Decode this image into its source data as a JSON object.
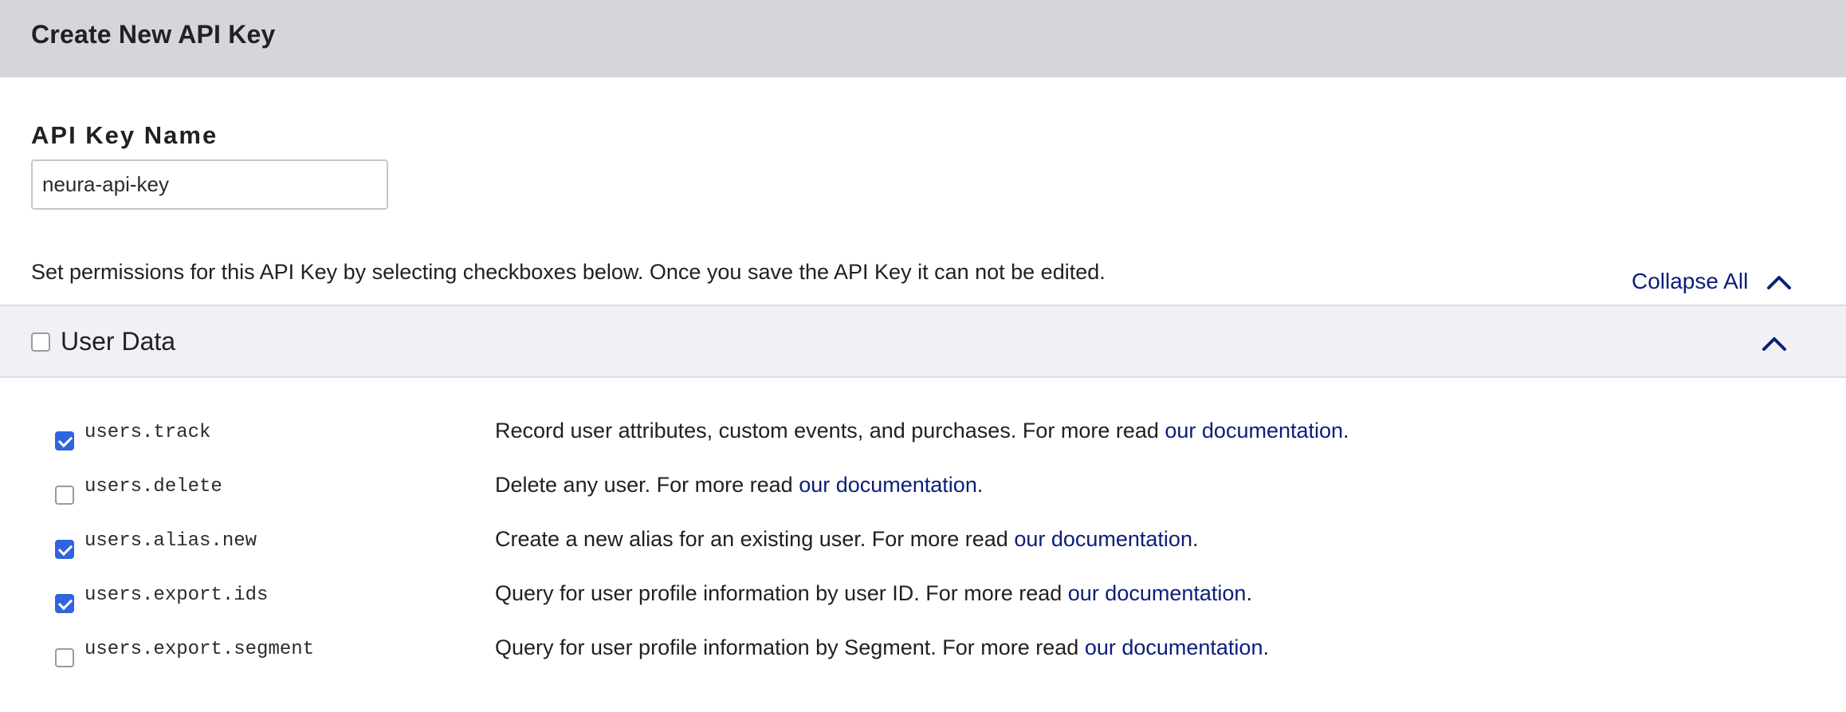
{
  "header": {
    "title": "Create New API Key"
  },
  "form": {
    "name_label": "API Key Name",
    "name_value": "neura-api-key",
    "instructions": "Set permissions for this API Key by selecting checkboxes below. Once you save the API Key it can not be edited.",
    "collapse_all_label": "Collapse All"
  },
  "section": {
    "title": "User Data",
    "checked": false
  },
  "permissions": [
    {
      "name": "users.track",
      "checked": true,
      "description": "Record user attributes, custom events, and purchases. For more read ",
      "link": "our documentation",
      "suffix": "."
    },
    {
      "name": "users.delete",
      "checked": false,
      "description": "Delete any user. For more read ",
      "link": "our documentation",
      "suffix": "."
    },
    {
      "name": "users.alias.new",
      "checked": true,
      "description": "Create a new alias for an existing user. For more read ",
      "link": "our documentation",
      "suffix": "."
    },
    {
      "name": "users.export.ids",
      "checked": true,
      "description": "Query for user profile information by user ID. For more read ",
      "link": "our documentation",
      "suffix": "."
    },
    {
      "name": "users.export.segment",
      "checked": false,
      "description": "Query for user profile information by Segment. For more read ",
      "link": "our documentation",
      "suffix": "."
    }
  ],
  "colors": {
    "header_bg": "#d5d5db",
    "link": "#0b1e7a",
    "checkbox_checked": "#2f63e0",
    "section_bg": "#f1f1f5"
  },
  "icons": {
    "collapse_all": "chevron-up-icon",
    "section_toggle": "chevron-up-icon",
    "checkbox_checked": "check-icon"
  }
}
